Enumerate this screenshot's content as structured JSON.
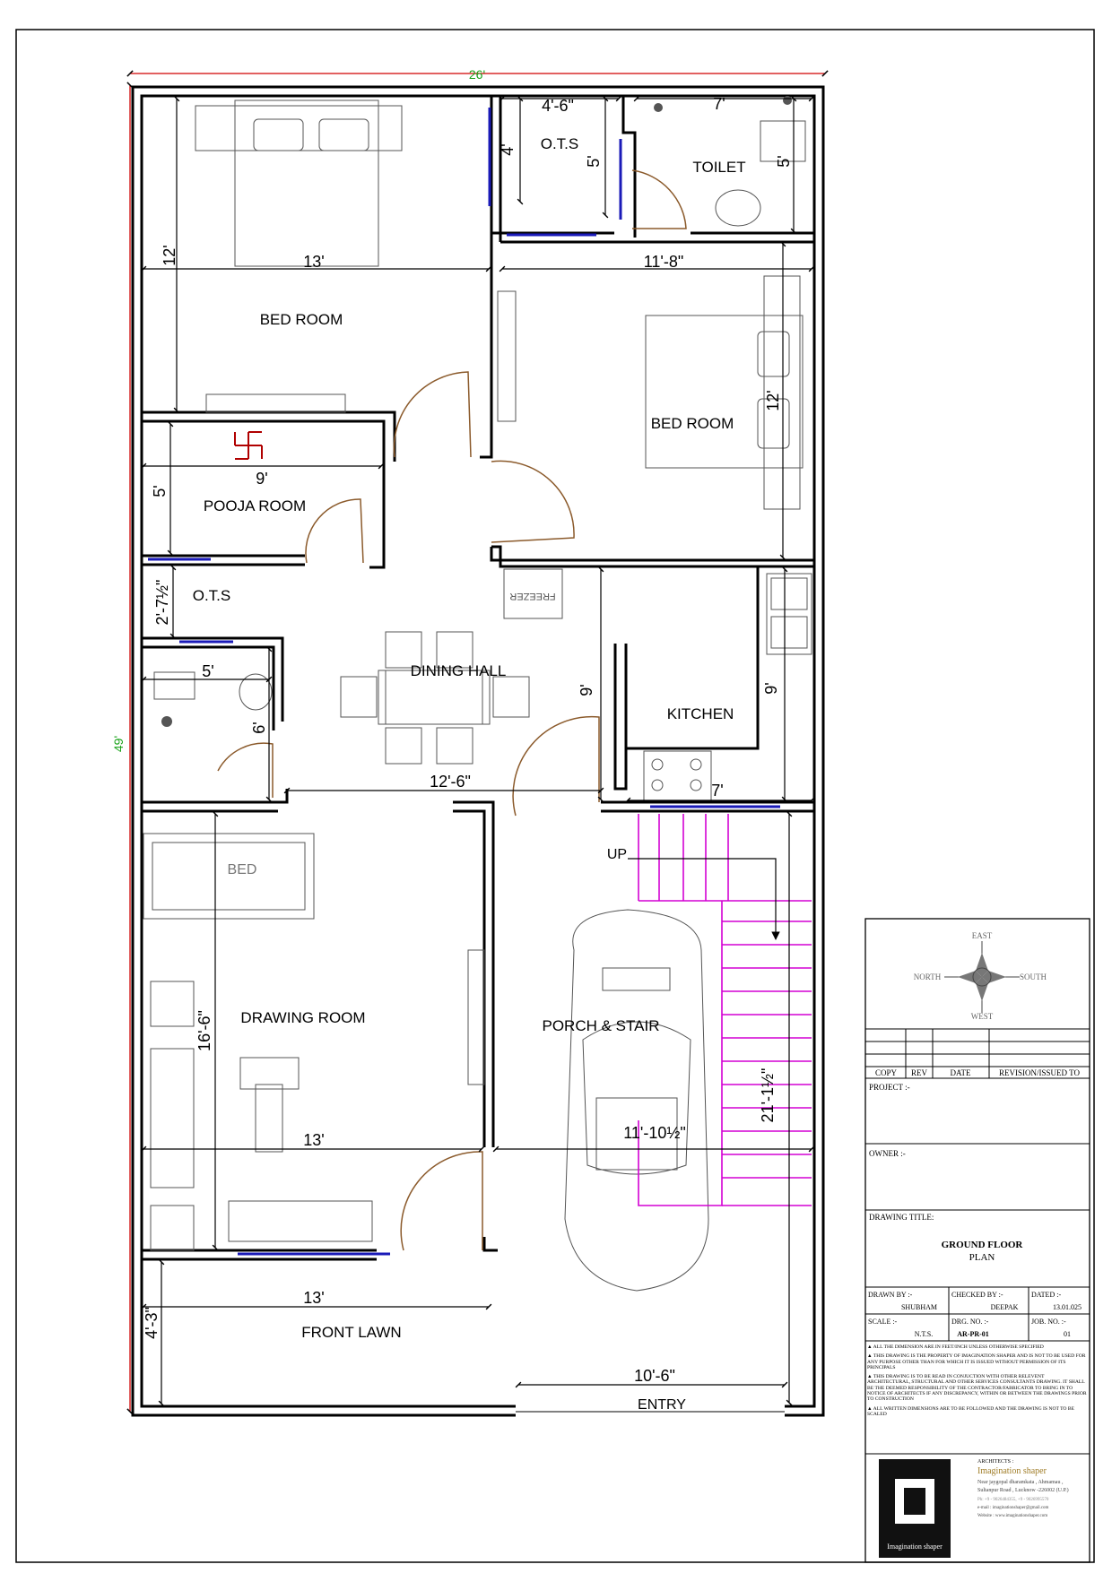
{
  "plan": {
    "overall_width": "26'",
    "overall_depth": "49'",
    "rooms": {
      "bed_room_1": "BED ROOM",
      "ots_1": "O.T.S",
      "toilet_1": "TOILET",
      "bed_room_2": "BED ROOM",
      "pooja_room": "POOJA ROOM",
      "ots_2": "O.T.S",
      "dining_hall": "DINING HALL",
      "kitchen": "KITCHEN",
      "drawing_room": "DRAWING ROOM",
      "porch_stair": "PORCH & STAIR",
      "front_lawn": "FRONT LAWN",
      "freezer": "FREEZER",
      "bed_furniture": "BED",
      "stair_up": "UP",
      "entry": "ENTRY"
    },
    "dimensions": {
      "br1_width": "13'",
      "br1_depth": "12'",
      "ots1_width": "4'-6\"",
      "ots1_depth": "4'",
      "ots1_depth_b": "5'",
      "toilet_width": "7'",
      "toilet_depth": "5'",
      "br2_width": "11'-8\"",
      "br2_depth": "12'",
      "pooja_width": "9'",
      "pooja_depth": "5'",
      "ots2_depth": "2'-7½\"",
      "toilet2_width": "5'",
      "toilet2_depth": "6'",
      "dining_depth": "9'",
      "dining_width": "12'-6\"",
      "kitchen_depth": "9'",
      "kitchen_width": "7'",
      "drawing_depth": "16'-6\"",
      "drawing_width": "13'",
      "porch_width": "11'-10½\"",
      "porch_depth": "21'-1½\"",
      "lawn_width": "13'",
      "lawn_depth": "4'-3\"",
      "gate_width": "10'-6\""
    }
  },
  "compass": {
    "n": "NORTH",
    "s": "SOUTH",
    "e": "EAST",
    "w": "WEST"
  },
  "title_block": {
    "revision_headers": [
      "COPY",
      "REV",
      "DATE",
      "REVISION/ISSUED TO"
    ],
    "project_label": "PROJECT :-",
    "owner_label": "OWNER :-",
    "drawing_title_label": "DRAWING TITLE:",
    "drawing_title_line1": "GROUND FLOOR",
    "drawing_title_line2": "PLAN",
    "drawn_by_label": "DRAWN BY :-",
    "drawn_by": "SHUBHAM",
    "checked_by_label": "CHECKED BY :-",
    "checked_by": "DEEPAK",
    "dated_label": "DATED :-",
    "dated": "13.01.025",
    "scale_label": "SCALE :-",
    "scale": "N.T.S.",
    "drg_no_label": "DRG. NO. :-",
    "drg_no": "AR-PR-01",
    "job_no_label": "JOB. NO. :-",
    "job_no": "01",
    "notes": [
      "ALL THE DIMENSION ARE IN FEET/INCH UNLESS OTHERWISE SPECIFIED",
      "THIS DRAWING IS THE PROPERTY OF IMAGINATION SHAPER AND IS NOT TO BE USED FOR ANY PURPOSE OTHER THAN FOR WHICH IT IS ISSUED WITHOUT PERMISSION OF ITS PRINCIPALS",
      "THIS DRAWING IS TO BE READ IN CONJUCTION WITH OTHER RELEVENT ARCHITECTURAL, STRUCTURAL AND OTHER SERVICES CONSULTANTS DRAWING. IT SHALL BE THE DEEMED RESPONSIBILITY OF THE CONTRACTOR/FABRICATOR TO BRING IN TO NOTICE OF ARCHITECTS IF ANY DISCREPANCY, WITHIN OR BETWEEN THE DRAWINGS PRIOR TO CONSTRUCTION",
      "ALL WRITTEN DIMENSIONS ARE TO BE FOLLOWED AND THE DRAWING IS NOT TO BE SCALED"
    ],
    "architects_label": "ARCHITECTS :",
    "firm_name": "Imagination shaper",
    "address_line1": "Near jaygopal dharamkata , Ahmamau ,",
    "address_line2": "Sultanpur Road , Lucknow -226002 (U.P.)",
    "phone": "Ph: +9 - 9026484355, +9 - 9026995570",
    "email": "e-mail : imaginationshaper@gmail.com",
    "website": "Website : www.imaginationshaper.com",
    "logo_caption": "Imagination shaper"
  }
}
